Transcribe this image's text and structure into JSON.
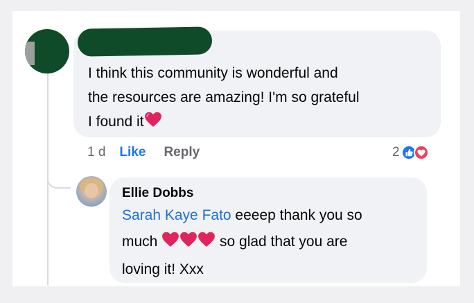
{
  "comment": {
    "text_line1": "I think this community is wonderful and",
    "text_line2": "the resources are amazing! I'm so grateful",
    "text_line3": "I found it",
    "time": "1 d",
    "like_label": "Like",
    "reply_label": "Reply",
    "reaction_count": "2"
  },
  "reply": {
    "author": "Ellie Dobbs",
    "mention": "Sarah Kaye Fato",
    "text_part1": " eeeep thank you so",
    "text_part2": "much ",
    "text_part3": " so glad that you are",
    "text_part4": "loving it! Xxx"
  },
  "colors": {
    "link_blue": "#1877f2",
    "mention_blue": "#216fdb",
    "heart_red": "#e0245e",
    "bubble_bg": "#f0f2f5",
    "redaction_green": "#0f4b28"
  },
  "icons": [
    "heart-icon",
    "like-reaction-icon",
    "love-reaction-icon"
  ]
}
